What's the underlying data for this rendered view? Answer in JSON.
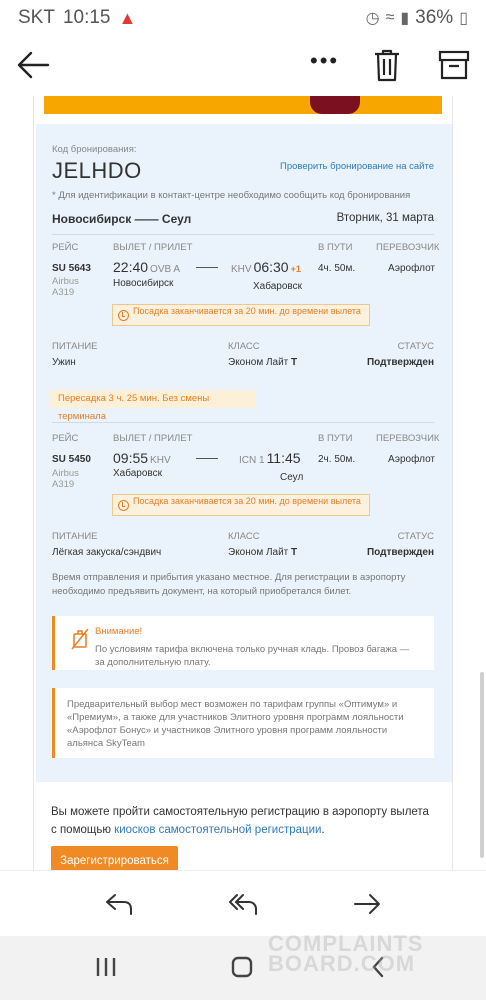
{
  "status_bar": {
    "carrier": "SKT",
    "time": "10:15",
    "battery": "36%"
  },
  "booking": {
    "code_label": "Код бронирования:",
    "code": "JELHDO",
    "check_link": "Проверить бронирование на сайте",
    "note": "* Для идентификации в контакт-центре необходимо сообщить код бронирования",
    "route": "Новосибирск —— Сеул",
    "date": "Вторник, 31 марта"
  },
  "headers": {
    "flight": "РЕЙС",
    "depart_arrive": "ВЫЛЕТ / ПРИЛЕТ",
    "en_route": "В ПУТИ",
    "carrier": "ПЕРЕВОЗЧИК",
    "meal": "ПИТАНИЕ",
    "class": "КЛАСС",
    "status": "СТАТУС"
  },
  "segments": [
    {
      "flight_no": "SU 5643",
      "aircraft_1": "Airbus",
      "aircraft_2": "A319",
      "dep_time": "22:40",
      "dep_code": "OVB A",
      "dep_city": "Новосибирск",
      "arr_code": "KHV",
      "arr_time": "06:30",
      "arr_plus": "+1",
      "arr_city": "Хабаровск",
      "duration": "4ч. 50м.",
      "carrier": "Аэрофлот",
      "boarding_note": "Посадка заканчивается за 20 мин. до времени вылета",
      "meal": "Ужин",
      "class": "Эконом Лайт",
      "class_code": "T",
      "status": "Подтвержден"
    },
    {
      "flight_no": "SU 5450",
      "aircraft_1": "Airbus",
      "aircraft_2": "A319",
      "dep_time": "09:55",
      "dep_code": "KHV",
      "dep_city": "Хабаровск",
      "arr_code": "ICN 1",
      "arr_time": "11:45",
      "arr_plus": "",
      "arr_city": "Сеул",
      "duration": "2ч. 50м.",
      "carrier": "Аэрофлот",
      "boarding_note": "Посадка заканчивается за 20 мин. до времени вылета",
      "meal": "Лёгкая закуска/сэндвич",
      "class": "Эконом Лайт",
      "class_code": "T",
      "status": "Подтвержден"
    }
  ],
  "transfer_note": "Пересадка 3 ч. 25 мин. Без смены терминала",
  "local_time_note": "Время отправления и прибытия указано местное. Для регистрации в аэропорту необходимо предъявить документ, на который приобретался билет.",
  "notice_luggage": {
    "title": "Внимание!",
    "text": "По условиям тарифа включена только ручная кладь. Провоз багажа — за дополнительную плату."
  },
  "notice_seats": {
    "text": "Предварительный выбор мест возможен по тарифам группы «Оптимум» и «Премиум», а также для участников Элитного уровня программ лояльности «Аэрофлот Бонус» и участников Элитного уровня программ лояльности альянса SkyTeam"
  },
  "self_registration": {
    "text_1": "Вы можете пройти самостоятельную регистрацию в аэропорту вылета",
    "text_2": "с помощью",
    "link": "киосков самостоятельной регистрации",
    "text_3": ".",
    "button": "Зарегистрироваться"
  },
  "watermark": {
    "line_1": "COMPLAINTS",
    "line_2": "BOARD.COM"
  },
  "colors": {
    "accent_orange": "#f08a24",
    "link_blue": "#2e7bbf",
    "card_bg": "#eaf3fb",
    "banner": "#f7a600"
  },
  "icons": {
    "back": "arrow-left-icon",
    "more": "more-dots-icon",
    "delete": "trash-icon",
    "archive": "archive-icon",
    "reply": "reply-icon",
    "reply_all": "reply-all-icon",
    "forward": "forward-icon"
  }
}
